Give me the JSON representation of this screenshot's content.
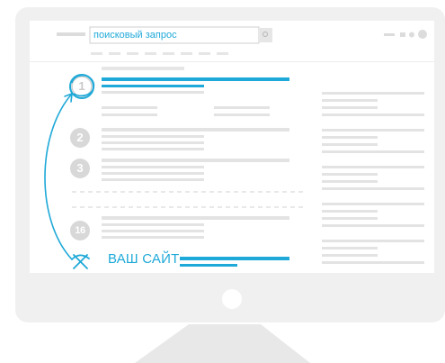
{
  "search": {
    "query": "поисковый запрос"
  },
  "results": {
    "ranks": [
      "1",
      "2",
      "3",
      "16"
    ]
  },
  "your_site": {
    "label": "ВАШ САЙТ"
  },
  "colors": {
    "accent": "#1fa9d8",
    "monitor_frame": "#f0f0f0",
    "screen": "#ffffff",
    "placeholder_line": "#e3e3e3",
    "circle": "#d8d8d8",
    "stand": "#e8e8e8"
  },
  "icons": [
    "search-icon",
    "window-controls-icon",
    "strike-cross-icon",
    "curved-arrow-icon",
    "power-button-icon"
  ]
}
